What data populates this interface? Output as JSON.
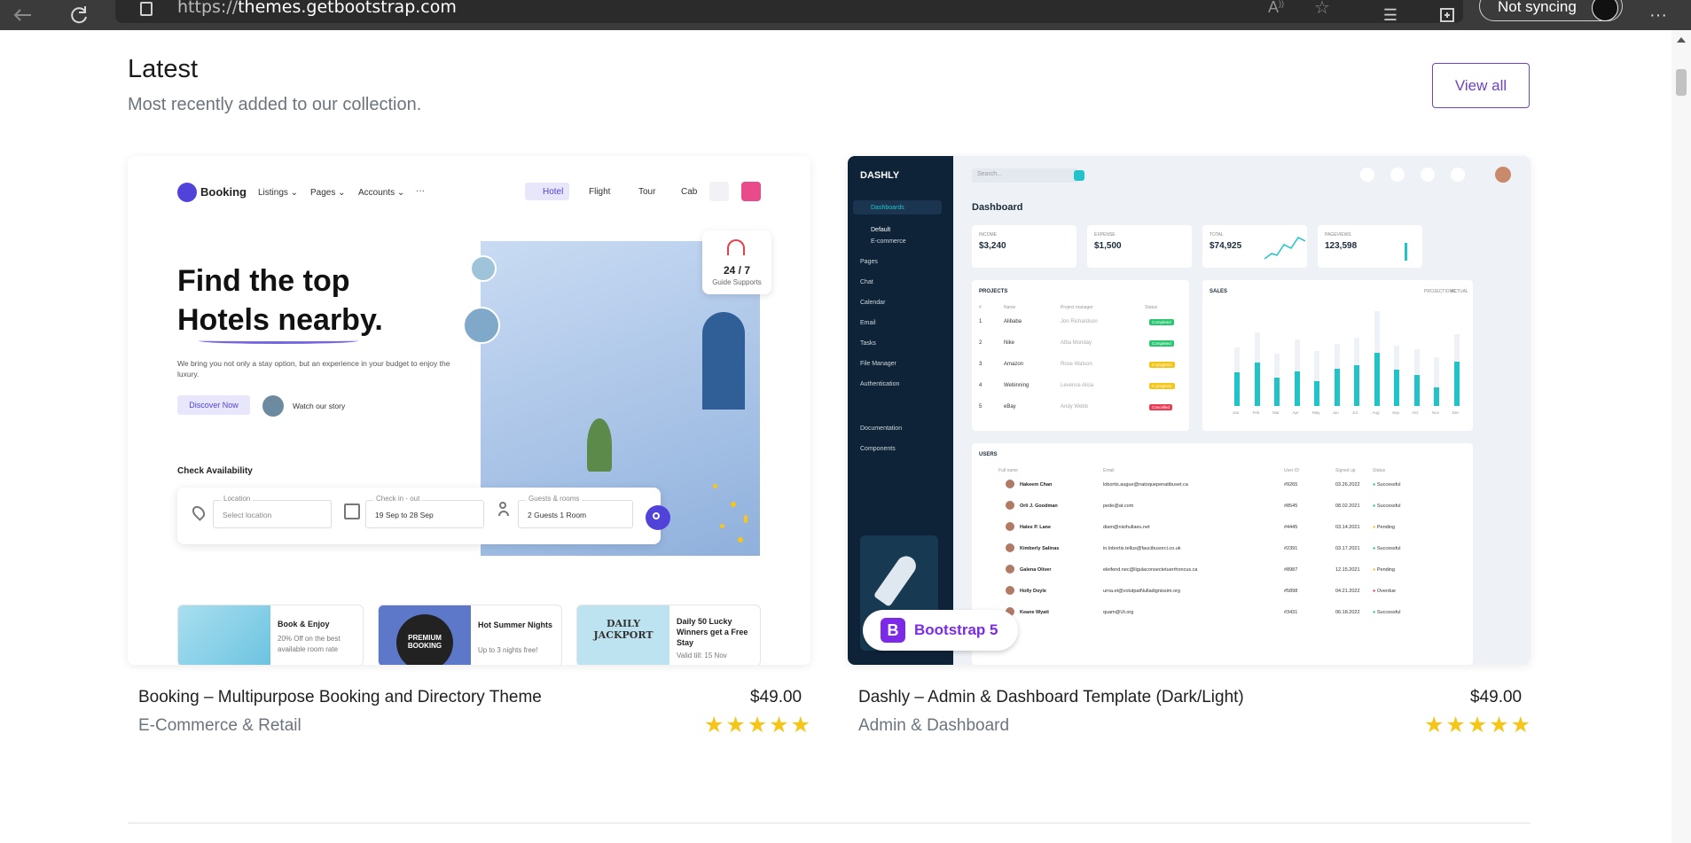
{
  "browser": {
    "url_scheme": "https://",
    "url_host": "themes.getbootstrap.com",
    "sync_label": "Not syncing"
  },
  "section": {
    "title": "Latest",
    "subtitle": "Most recently added to our collection.",
    "view_all_label": "View all"
  },
  "products": [
    {
      "title": "Booking – Multipurpose Booking and Directory Theme",
      "price": "$49.00",
      "category": "E-Commerce & Retail",
      "stars": "★★★★★"
    },
    {
      "title": "Dashly – Admin & Dashboard Template (Dark/Light)",
      "price": "$49.00",
      "category": "Admin & Dashboard",
      "stars": "★★★★★"
    }
  ],
  "booking_preview": {
    "logo": "Booking",
    "nav": [
      "Listings ⌄",
      "Pages ⌄",
      "Accounts ⌄",
      "···"
    ],
    "tabs": [
      "Hotel",
      "Flight",
      "Tour",
      "Cab"
    ],
    "headline_1": "Find the top",
    "headline_2": "Hotels nearby.",
    "desc": "We bring you not only a stay option, but an experience in your budget to enjoy the luxury.",
    "cta": "Discover Now",
    "watch": "Watch our story",
    "support_big": "24 / 7",
    "support_small": "Guide Supports",
    "check_title": "Check Availability",
    "loc_label": "Location",
    "loc_value": "Select location",
    "check_label": "Check in - out",
    "check_value": "19 Sep to 28 Sep",
    "guest_label": "Guests & rooms",
    "guest_value": "2 Guests 1 Room",
    "promo1_title": "Book & Enjoy",
    "promo1_text": "20% Off on the best available room rate",
    "promo2_title": "Hot Summer Nights",
    "promo2_text": "Up to 3 nights free!",
    "promo2_img": "PREMIUM BOOKING",
    "promo3_title": "Daily 50 Lucky Winners get a Free Stay",
    "promo3_text": "Valid till: 15 Nov",
    "promo3_img": "DAILY JACKPORT"
  },
  "dashly_preview": {
    "logo": "DASHLY",
    "search": "Search...",
    "page_title": "Dashboard",
    "sidebar": [
      "Dashboards",
      "Default",
      "E-commerce",
      "Pages",
      "Chat",
      "Calendar",
      "Email",
      "Tasks",
      "File Manager",
      "Authentication",
      "Documentation",
      "Components"
    ],
    "stats": [
      {
        "label": "INCOME",
        "value": "$3,240"
      },
      {
        "label": "EXPENSE",
        "value": "$1,500"
      },
      {
        "label": "TOTAL",
        "value": "$74,925"
      },
      {
        "label": "PAGEVIEWS",
        "value": "123,598"
      }
    ],
    "projects_title": "PROJECTS",
    "projects_cols": [
      "#",
      "Name",
      "Project manager",
      "Status"
    ],
    "projects": [
      {
        "n": "1",
        "name": "Alibaba",
        "pm": "Jon Richardson",
        "status": "Completed",
        "color": "#28c76f"
      },
      {
        "n": "2",
        "name": "Nike",
        "pm": "Alba Monday",
        "status": "Completed",
        "color": "#28c76f"
      },
      {
        "n": "3",
        "name": "Amazon",
        "pm": "Rose Watson",
        "status": "In progress",
        "color": "#f5c518"
      },
      {
        "n": "4",
        "name": "Webinning",
        "pm": "Levence Alcia",
        "status": "In progress",
        "color": "#f5c518"
      },
      {
        "n": "5",
        "name": "eBay",
        "pm": "Andy Webb",
        "status": "Cancelled",
        "color": "#ea3c53"
      }
    ],
    "sales_title": "SALES",
    "sales_legend": [
      "PROJECTIONS",
      "ACTUAL"
    ],
    "sales_months": [
      "Jan",
      "Feb",
      "Mar",
      "Apr",
      "May",
      "Jun",
      "Jul",
      "Aug",
      "Sep",
      "Oct",
      "Nov",
      "Dec"
    ],
    "sales_actual": [
      0.33,
      0.42,
      0.28,
      0.34,
      0.24,
      0.36,
      0.4,
      0.52,
      0.35,
      0.3,
      0.18,
      0.43
    ],
    "sales_projection": [
      0.62,
      0.78,
      0.55,
      0.7,
      0.58,
      0.66,
      0.72,
      1.0,
      0.64,
      0.6,
      0.52,
      0.76
    ],
    "users_title": "USERS",
    "users_cols": [
      "Full name",
      "Email",
      "User ID",
      "Signed up",
      "Status"
    ],
    "users": [
      {
        "name": "Hakeem Chan",
        "email": "lobortis.augue@natoquepenatibuset.ca",
        "id": "#9265",
        "date": "03.26.2022",
        "status": "Successful",
        "color": "#28c76f"
      },
      {
        "name": "Orli J. Goodman",
        "email": "pede@at.com",
        "id": "#8545",
        "date": "08.02.2021",
        "status": "Successful",
        "color": "#28c76f"
      },
      {
        "name": "Halee P. Lane",
        "email": "diam@nisihullaeu.net",
        "id": "#4445",
        "date": "03.14.2021",
        "status": "Pending",
        "color": "#f5c518"
      },
      {
        "name": "Kimberly Salinas",
        "email": "in.lobortis.tellus@faucibusorci.co.uk",
        "id": "#2391",
        "date": "03.17.2021",
        "status": "Successful",
        "color": "#28c76f"
      },
      {
        "name": "Galena Oliver",
        "email": "eleifend.nec@ligulaconsectetuerrhoncus.ca",
        "id": "#8987",
        "date": "12.15.2021",
        "status": "Pending",
        "color": "#f5c518"
      },
      {
        "name": "Holly Doyle",
        "email": "urna.et@volutpatNulladignissim.org",
        "id": "#5898",
        "date": "04.21.2022",
        "status": "Overdue",
        "color": "#ea3c53"
      },
      {
        "name": "Keane Wyatt",
        "email": "quam@Ut.org",
        "id": "#3431",
        "date": "06.18.2022",
        "status": "Successful",
        "color": "#28c76f"
      }
    ],
    "badge": "Bootstrap 5"
  }
}
